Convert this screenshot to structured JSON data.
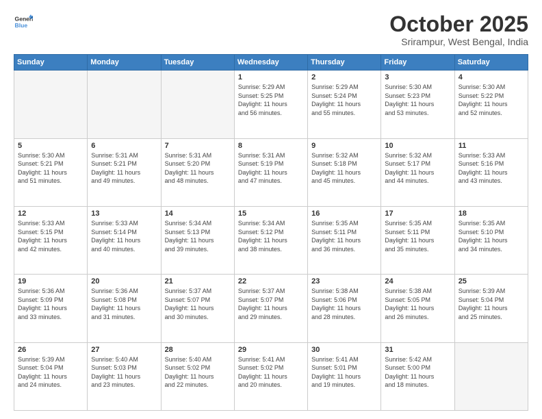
{
  "header": {
    "logo_general": "General",
    "logo_blue": "Blue",
    "month": "October 2025",
    "location": "Srirampur, West Bengal, India"
  },
  "weekdays": [
    "Sunday",
    "Monday",
    "Tuesday",
    "Wednesday",
    "Thursday",
    "Friday",
    "Saturday"
  ],
  "weeks": [
    [
      {
        "day": "",
        "info": ""
      },
      {
        "day": "",
        "info": ""
      },
      {
        "day": "",
        "info": ""
      },
      {
        "day": "1",
        "info": "Sunrise: 5:29 AM\nSunset: 5:25 PM\nDaylight: 11 hours\nand 56 minutes."
      },
      {
        "day": "2",
        "info": "Sunrise: 5:29 AM\nSunset: 5:24 PM\nDaylight: 11 hours\nand 55 minutes."
      },
      {
        "day": "3",
        "info": "Sunrise: 5:30 AM\nSunset: 5:23 PM\nDaylight: 11 hours\nand 53 minutes."
      },
      {
        "day": "4",
        "info": "Sunrise: 5:30 AM\nSunset: 5:22 PM\nDaylight: 11 hours\nand 52 minutes."
      }
    ],
    [
      {
        "day": "5",
        "info": "Sunrise: 5:30 AM\nSunset: 5:21 PM\nDaylight: 11 hours\nand 51 minutes."
      },
      {
        "day": "6",
        "info": "Sunrise: 5:31 AM\nSunset: 5:21 PM\nDaylight: 11 hours\nand 49 minutes."
      },
      {
        "day": "7",
        "info": "Sunrise: 5:31 AM\nSunset: 5:20 PM\nDaylight: 11 hours\nand 48 minutes."
      },
      {
        "day": "8",
        "info": "Sunrise: 5:31 AM\nSunset: 5:19 PM\nDaylight: 11 hours\nand 47 minutes."
      },
      {
        "day": "9",
        "info": "Sunrise: 5:32 AM\nSunset: 5:18 PM\nDaylight: 11 hours\nand 45 minutes."
      },
      {
        "day": "10",
        "info": "Sunrise: 5:32 AM\nSunset: 5:17 PM\nDaylight: 11 hours\nand 44 minutes."
      },
      {
        "day": "11",
        "info": "Sunrise: 5:33 AM\nSunset: 5:16 PM\nDaylight: 11 hours\nand 43 minutes."
      }
    ],
    [
      {
        "day": "12",
        "info": "Sunrise: 5:33 AM\nSunset: 5:15 PM\nDaylight: 11 hours\nand 42 minutes."
      },
      {
        "day": "13",
        "info": "Sunrise: 5:33 AM\nSunset: 5:14 PM\nDaylight: 11 hours\nand 40 minutes."
      },
      {
        "day": "14",
        "info": "Sunrise: 5:34 AM\nSunset: 5:13 PM\nDaylight: 11 hours\nand 39 minutes."
      },
      {
        "day": "15",
        "info": "Sunrise: 5:34 AM\nSunset: 5:12 PM\nDaylight: 11 hours\nand 38 minutes."
      },
      {
        "day": "16",
        "info": "Sunrise: 5:35 AM\nSunset: 5:11 PM\nDaylight: 11 hours\nand 36 minutes."
      },
      {
        "day": "17",
        "info": "Sunrise: 5:35 AM\nSunset: 5:11 PM\nDaylight: 11 hours\nand 35 minutes."
      },
      {
        "day": "18",
        "info": "Sunrise: 5:35 AM\nSunset: 5:10 PM\nDaylight: 11 hours\nand 34 minutes."
      }
    ],
    [
      {
        "day": "19",
        "info": "Sunrise: 5:36 AM\nSunset: 5:09 PM\nDaylight: 11 hours\nand 33 minutes."
      },
      {
        "day": "20",
        "info": "Sunrise: 5:36 AM\nSunset: 5:08 PM\nDaylight: 11 hours\nand 31 minutes."
      },
      {
        "day": "21",
        "info": "Sunrise: 5:37 AM\nSunset: 5:07 PM\nDaylight: 11 hours\nand 30 minutes."
      },
      {
        "day": "22",
        "info": "Sunrise: 5:37 AM\nSunset: 5:07 PM\nDaylight: 11 hours\nand 29 minutes."
      },
      {
        "day": "23",
        "info": "Sunrise: 5:38 AM\nSunset: 5:06 PM\nDaylight: 11 hours\nand 28 minutes."
      },
      {
        "day": "24",
        "info": "Sunrise: 5:38 AM\nSunset: 5:05 PM\nDaylight: 11 hours\nand 26 minutes."
      },
      {
        "day": "25",
        "info": "Sunrise: 5:39 AM\nSunset: 5:04 PM\nDaylight: 11 hours\nand 25 minutes."
      }
    ],
    [
      {
        "day": "26",
        "info": "Sunrise: 5:39 AM\nSunset: 5:04 PM\nDaylight: 11 hours\nand 24 minutes."
      },
      {
        "day": "27",
        "info": "Sunrise: 5:40 AM\nSunset: 5:03 PM\nDaylight: 11 hours\nand 23 minutes."
      },
      {
        "day": "28",
        "info": "Sunrise: 5:40 AM\nSunset: 5:02 PM\nDaylight: 11 hours\nand 22 minutes."
      },
      {
        "day": "29",
        "info": "Sunrise: 5:41 AM\nSunset: 5:02 PM\nDaylight: 11 hours\nand 20 minutes."
      },
      {
        "day": "30",
        "info": "Sunrise: 5:41 AM\nSunset: 5:01 PM\nDaylight: 11 hours\nand 19 minutes."
      },
      {
        "day": "31",
        "info": "Sunrise: 5:42 AM\nSunset: 5:00 PM\nDaylight: 11 hours\nand 18 minutes."
      },
      {
        "day": "",
        "info": ""
      }
    ]
  ]
}
